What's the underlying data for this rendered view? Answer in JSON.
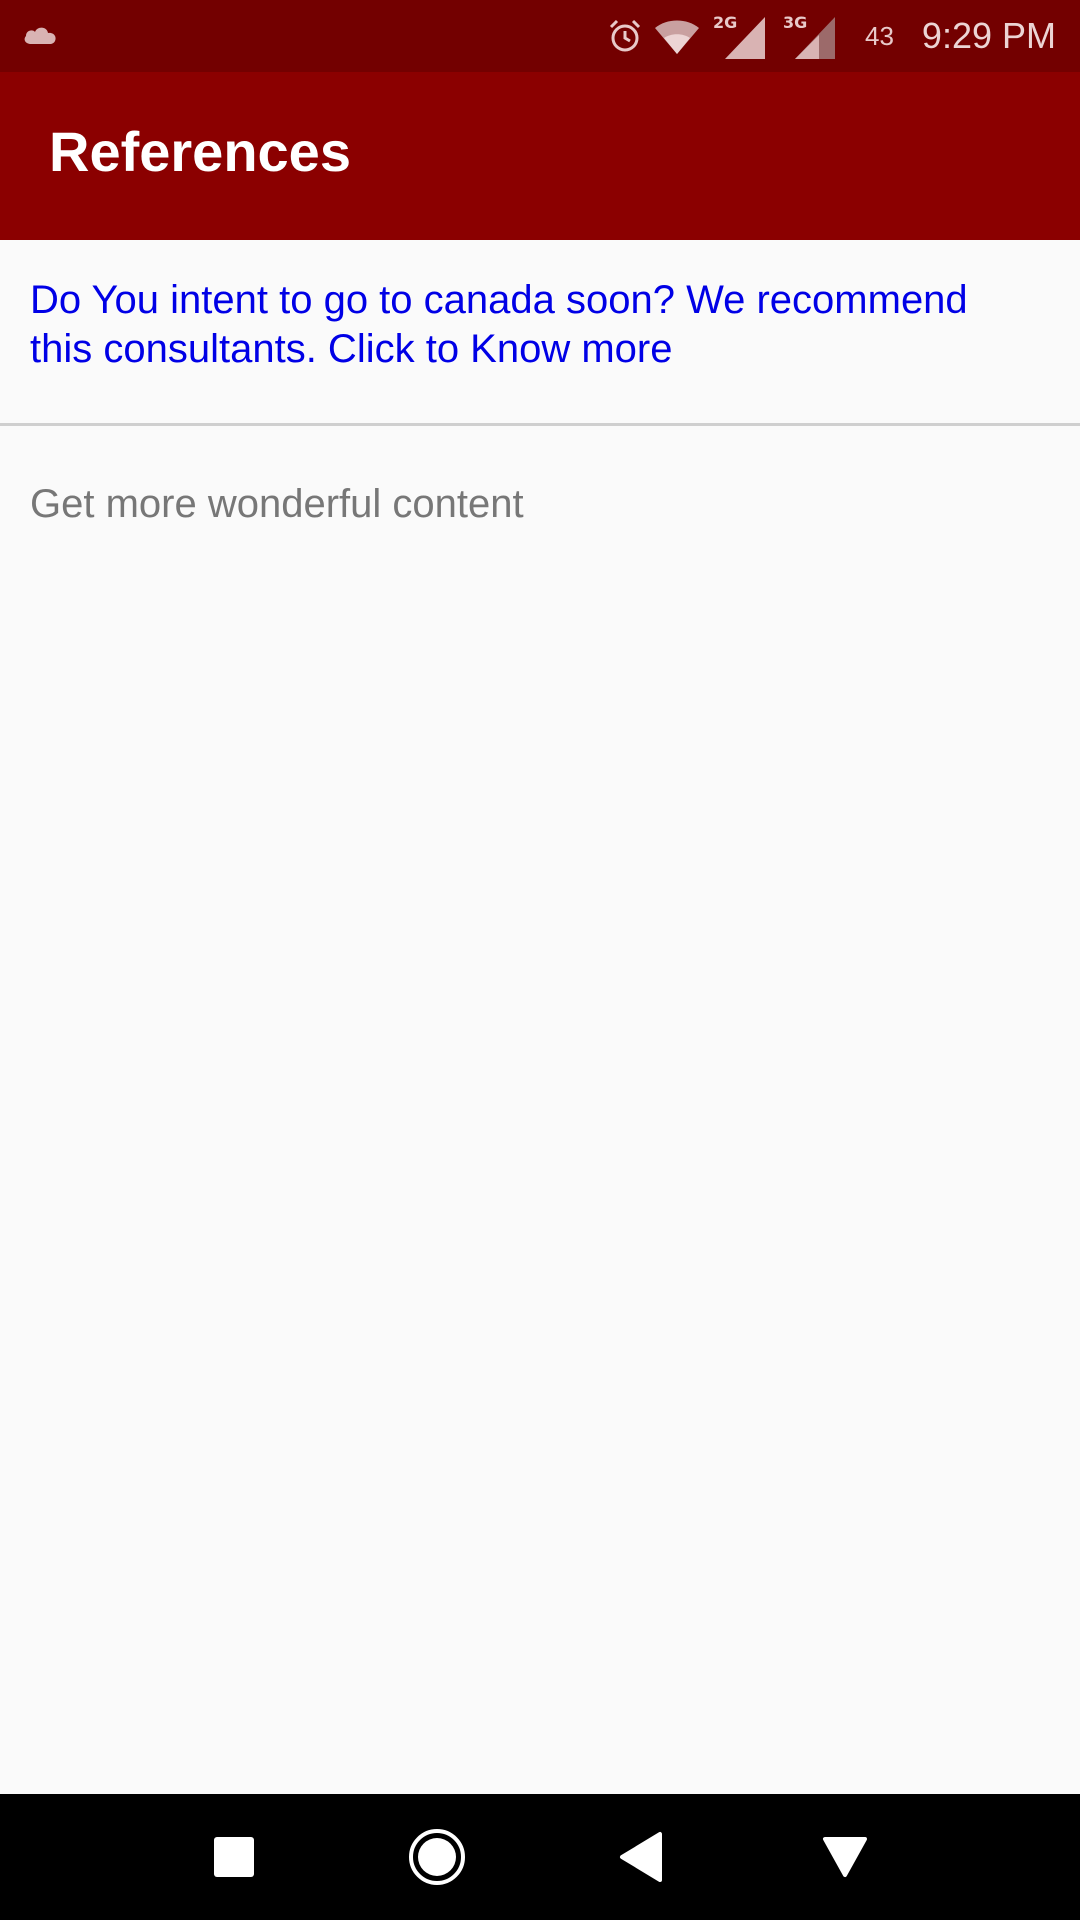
{
  "status_bar": {
    "time": "9:29 PM",
    "battery": "43",
    "network_1": "2G",
    "network_2": "3G",
    "icons": [
      "cloud-icon",
      "alarm-icon",
      "wifi-icon",
      "signal-2g-icon",
      "signal-3g-icon"
    ]
  },
  "app_bar": {
    "title": "References"
  },
  "content": {
    "promo_link": "Do You intent to go to canada soon? We recommend this consultants. Click to Know more",
    "more_text": "Get more wonderful content"
  },
  "nav_bar": {
    "icons": [
      "recents-square-icon",
      "home-circle-icon",
      "back-triangle-icon",
      "notification-down-triangle-icon"
    ]
  },
  "colors": {
    "status_bar_bg": "#730000",
    "app_bar_bg": "#8b0000",
    "link_color": "#0000e6",
    "muted_text": "#777777"
  }
}
